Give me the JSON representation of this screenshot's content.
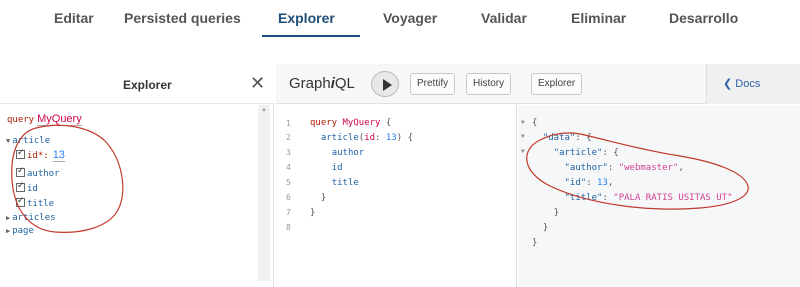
{
  "topnav": {
    "tabs": [
      {
        "label": "Editar"
      },
      {
        "label": "Persisted queries"
      },
      {
        "label": "Explorer"
      },
      {
        "label": "Voyager"
      },
      {
        "label": "Validar"
      },
      {
        "label": "Eliminar"
      },
      {
        "label": "Desarrollo"
      }
    ],
    "active_tab": "Explorer"
  },
  "explorer": {
    "title": "Explorer",
    "close_glyph": "✕",
    "query_keyword": "query",
    "query_name": "MyQuery",
    "tree": {
      "article": "article",
      "fields": [
        "id*:",
        "author",
        "id",
        "title"
      ],
      "id_value": "13",
      "collapsed": [
        "articles",
        "page"
      ]
    }
  },
  "toolbar": {
    "logo_prefix": "Graph",
    "logo_i": "i",
    "logo_suffix": "QL",
    "prettify": "Prettify",
    "history": "History",
    "explorer": "Explorer",
    "docs": "❮ Docs"
  },
  "editor": {
    "line_numbers": [
      "1",
      "2",
      "3",
      "4",
      "5",
      "6",
      "7",
      "8"
    ],
    "l1_kw": "query",
    "l1_name": "MyQuery",
    "l1_brace": " {",
    "l2_field": "article",
    "l2_open": "(",
    "l2_arg": "id",
    "l2_colon": ": ",
    "l2_val": "13",
    "l2_close": ") {",
    "l3": "author",
    "l4": "id",
    "l5": "title",
    "l6": "}",
    "l7": "}"
  },
  "result": {
    "r1": "{",
    "r2_key": "\"data\"",
    "r2_rest": ": {",
    "r3_key": "\"article\"",
    "r3_rest": ": {",
    "r4_key": "\"author\"",
    "r4_colon": ": ",
    "r4_val": "\"webmaster\"",
    "r4_comma": ",",
    "r5_key": "\"id\"",
    "r5_colon": ": ",
    "r5_val": "13",
    "r5_comma": ",",
    "r6_key": "\"title\"",
    "r6_colon": ": ",
    "r6_val": "\"PALA RATIS USITAS UT\"",
    "r7": "}",
    "r8": "}",
    "r9": "}"
  },
  "colors": {
    "annotation": "#c0392b",
    "accent": "#1f4e79"
  }
}
